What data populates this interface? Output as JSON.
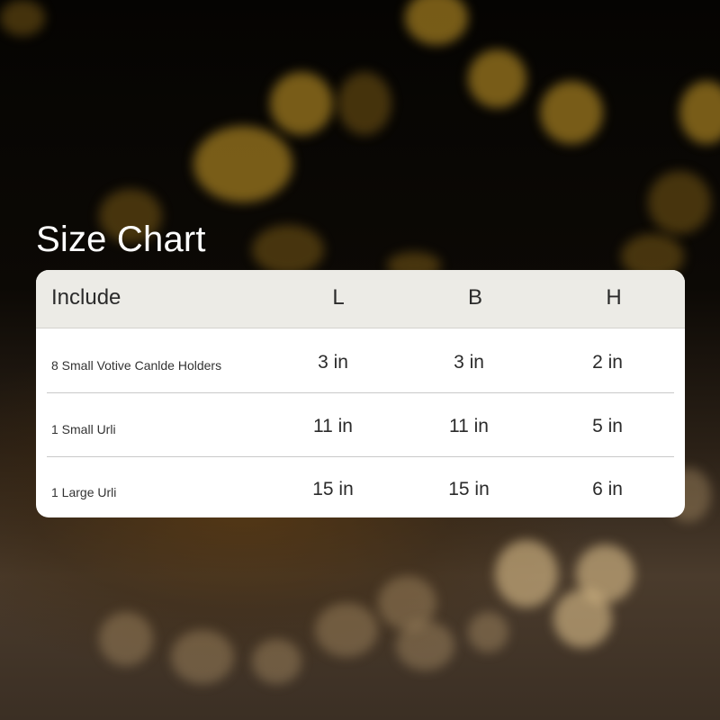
{
  "title": "Size Chart",
  "colors": {
    "card_background": "#ffffff",
    "header_background": "#ecebe6",
    "title_text": "#ffffff",
    "body_text": "#2b2b2b",
    "bokeh_gold": "#d6a42a"
  },
  "table": {
    "headers": {
      "include": "Include",
      "length": "L",
      "breadth": "B",
      "height": "H"
    },
    "rows": [
      {
        "item": "8 Small Votive Canlde Holders",
        "l": "3 in",
        "b": "3 in",
        "h": "2 in"
      },
      {
        "item": "1 Small Urli",
        "l": "11 in",
        "b": "11 in",
        "h": "5 in"
      },
      {
        "item": "1 Large Urli",
        "l": "15 in",
        "b": "15 in",
        "h": "6 in"
      }
    ]
  }
}
